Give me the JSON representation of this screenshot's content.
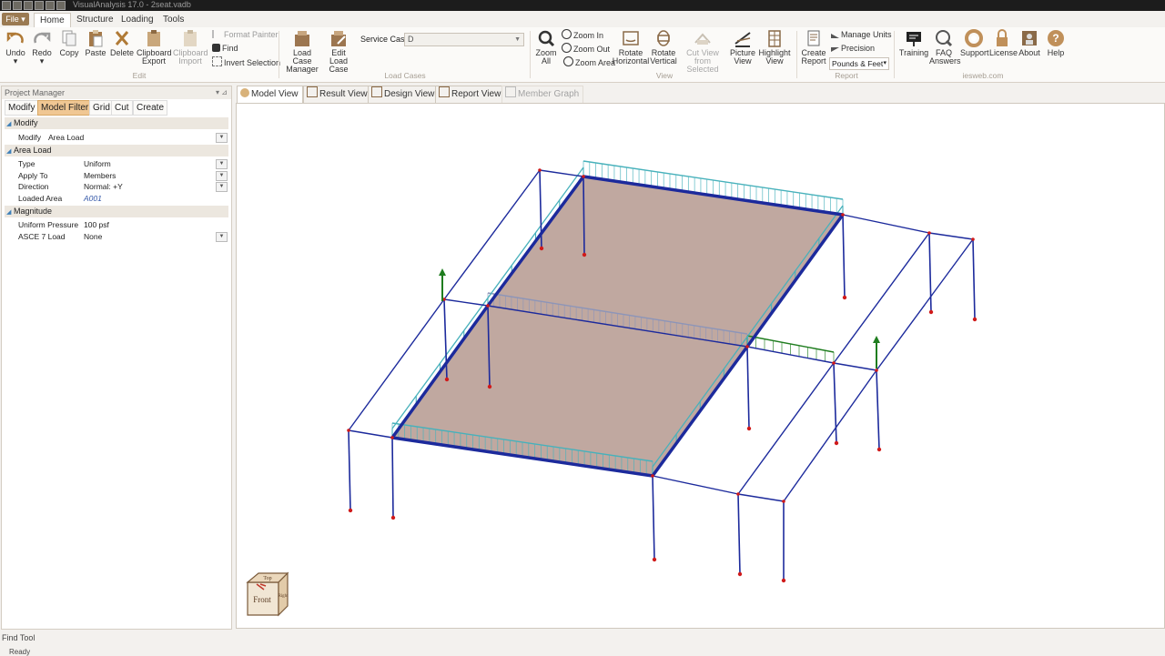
{
  "titlebar": {
    "title": "VisualAnalysis 17.0 - 2seat.vadb"
  },
  "menu": {
    "file": "File ▾",
    "tabs": [
      "Home",
      "Structure",
      "Loading",
      "Tools"
    ]
  },
  "ribbon": {
    "undo": "Undo",
    "redo": "Redo",
    "copy": "Copy",
    "paste": "Paste",
    "delete": "Delete",
    "clipboard_export": [
      "Clipboard",
      "Export"
    ],
    "clipboard_import": [
      "Clipboard",
      "Import"
    ],
    "format_painter": "Format Painter",
    "find": "Find",
    "invert_selection": "Invert Selection",
    "edit_group": "Edit",
    "load_case_manager": [
      "Load Case",
      "Manager"
    ],
    "edit_load_case": [
      "Edit Load",
      "Case"
    ],
    "service_case_label": "Service Case",
    "service_case_value": "D",
    "load_cases_group": "Load Cases",
    "zoom_all": [
      "Zoom",
      "All"
    ],
    "zoom_in": "Zoom In",
    "zoom_out": "Zoom Out",
    "zoom_area": "Zoom Area",
    "rotate_horizontal": [
      "Rotate",
      "Horizontal"
    ],
    "rotate_vertical": [
      "Rotate",
      "Vertical"
    ],
    "cut_view": [
      "Cut View from",
      "Selected"
    ],
    "picture_view": [
      "Picture",
      "View"
    ],
    "highlight_view": [
      "Highlight",
      "View"
    ],
    "view_group": "View",
    "create_report": [
      "Create",
      "Report"
    ],
    "manage_units": "Manage Units",
    "precision": "Precision",
    "units_value": "Pounds & Feet",
    "report_group": "Report",
    "training": "Training",
    "faq_answers": [
      "FAQ",
      "Answers"
    ],
    "support": "Support",
    "license": "License",
    "about": "About",
    "help": "Help",
    "iesweb_group": "iesweb.com"
  },
  "project_manager": {
    "title": "Project Manager",
    "tabs": [
      "Modify",
      "Model Filter",
      "Grid",
      "Cut",
      "Create"
    ],
    "active_tab": "Model Filter",
    "sections": {
      "modify": "Modify",
      "area_load": "Area Load",
      "magnitude": "Magnitude"
    },
    "modify_row": {
      "label": "Modify",
      "value": "Area Load"
    },
    "type": {
      "label": "Type",
      "value": "Uniform"
    },
    "apply_to": {
      "label": "Apply To",
      "value": "Members"
    },
    "direction": {
      "label": "Direction",
      "value": "Normal: +Y"
    },
    "loaded_area": {
      "label": "Loaded Area",
      "value": "A001"
    },
    "uniform_pressure": {
      "label": "Uniform Pressure",
      "value": "100 psf"
    },
    "asce7_load": {
      "label": "ASCE 7 Load",
      "value": "None"
    }
  },
  "view_tabs": {
    "model": "Model View",
    "result": "Result View",
    "design": "Design View",
    "report": "Report View",
    "member_graph": "Member Graph"
  },
  "viewcube": {
    "front": "Front",
    "top": "Top",
    "right": "Right"
  },
  "status": {
    "find_tool": "Find Tool",
    "ready": "Ready"
  },
  "colors": {
    "member": "#1c2a9c",
    "load": "#47b1bb",
    "area_fill": "#b5998f",
    "node": "#d01a1a",
    "support_arrow": "#1f7d1f",
    "accent": "#f0c793"
  }
}
